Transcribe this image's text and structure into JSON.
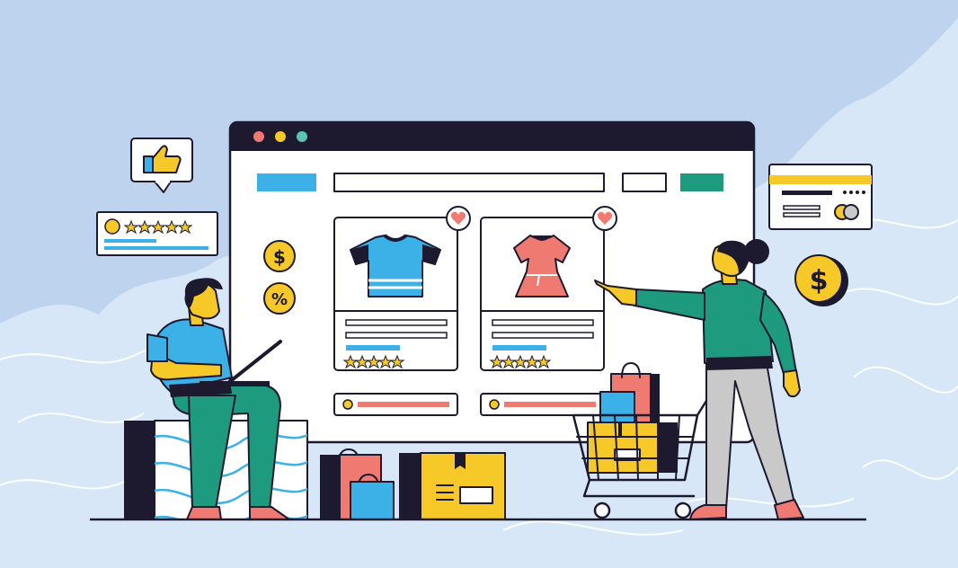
{
  "symbols": {
    "dollar": "$",
    "percent": "%"
  },
  "ratings": {
    "review_card_stars": 5,
    "tshirt_card_stars": 5,
    "dress_card_stars": 5
  },
  "colors": {
    "background": "#bdd3ee",
    "wave": "#d7e6f8",
    "ink": "#1d1a2f",
    "blue": "#3bb1e8",
    "teal": "#1e9a7f",
    "pink": "#ef7a72",
    "yellow": "#f7c928",
    "grey": "#c9c9c9"
  },
  "icons": [
    "thumbs-up-icon",
    "heart-icon",
    "star-icon",
    "dollar-coin-icon",
    "percent-coin-icon",
    "credit-card-icon",
    "shopping-cart-icon",
    "shopping-bag-icon",
    "package-box-icon",
    "laptop-icon"
  ]
}
